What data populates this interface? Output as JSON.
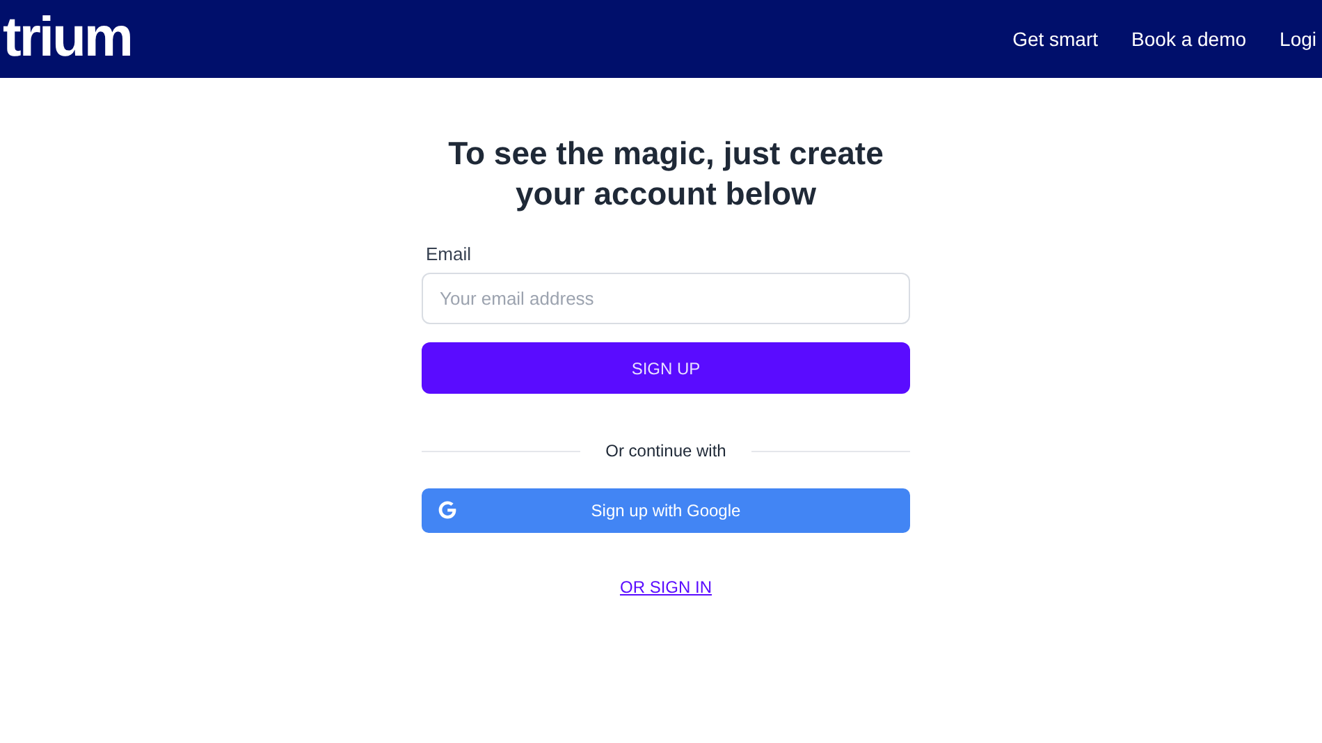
{
  "header": {
    "logo": "trium",
    "nav": [
      "Get smart",
      "Book a demo",
      "Logi"
    ]
  },
  "form": {
    "heading": "To see the magic, just create your account below",
    "email_label": "Email",
    "email_placeholder": "Your email address",
    "submit": "SIGN UP",
    "divider": "Or continue with",
    "google": "Sign up with Google",
    "signin_link": "OR SIGN IN"
  }
}
